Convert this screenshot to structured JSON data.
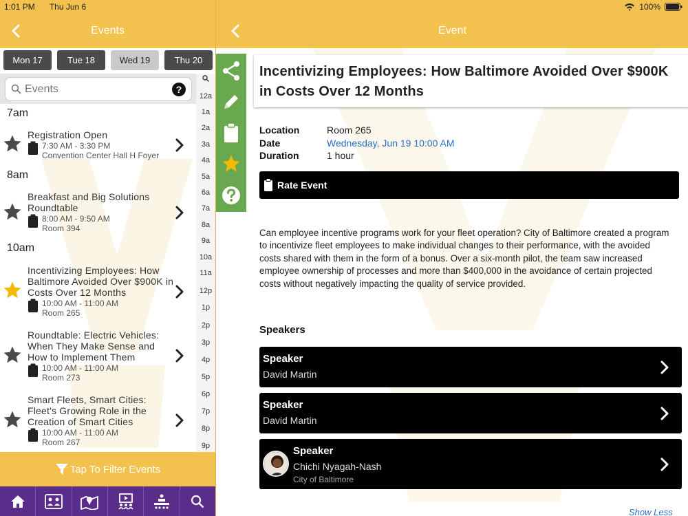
{
  "colors": {
    "accent": "#f2c14e",
    "tabbar": "#5a2d8a",
    "actions": "#6aa84f",
    "star_active": "#f5b800",
    "star_inactive": "#4a4a4a",
    "link": "#2a6fc9"
  },
  "status": {
    "time": "1:01 PM",
    "date": "Thu Jun 6",
    "battery": "100%"
  },
  "left": {
    "nav_title": "Events",
    "days": [
      {
        "label": "Mon 17",
        "active": false
      },
      {
        "label": "Tue 18",
        "active": false
      },
      {
        "label": "Wed 19",
        "active": true
      },
      {
        "label": "Thu 20",
        "active": false
      }
    ],
    "search_placeholder": "Events",
    "help_icon": "?",
    "index": [
      "12a",
      "1a",
      "2a",
      "3a",
      "4a",
      "5a",
      "6a",
      "7a",
      "8a",
      "9a",
      "10a",
      "11a",
      "12p",
      "1p",
      "2p",
      "3p",
      "4p",
      "5p",
      "6p",
      "7p",
      "8p",
      "9p"
    ],
    "hours": [
      "7am",
      "8am",
      "10am"
    ],
    "events": [
      {
        "title": "Registration Open",
        "time": "7:30 AM - 3:30 PM",
        "location": "Convention Center Hall H Foyer",
        "starred": false
      },
      {
        "title": "Breakfast and Big Solutions Roundtable",
        "time": "8:00 AM - 9:50 AM",
        "location": "Room 394",
        "starred": false
      },
      {
        "title": "Incentivizing Employees: How Baltimore Avoided Over $900K in Costs Over 12 Months",
        "time": "10:00 AM - 11:00 AM",
        "location": "Room 265",
        "starred": true
      },
      {
        "title": "Roundtable: Electric Vehicles: When They Make Sense and How to Implement Them",
        "time": "10:00 AM - 11:00 AM",
        "location": "Room 273",
        "starred": false
      },
      {
        "title": "Smart Fleets, Smart Cities: Fleet's Growing Role in the Creation of Smart Cities",
        "time": "10:00 AM - 11:00 AM",
        "location": "Room 267",
        "starred": false
      }
    ],
    "filter_label": "Tap To Filter Events",
    "tabs": [
      "home-icon",
      "attendees-icon",
      "map-icon",
      "presentations-icon",
      "exhibitors-icon",
      "search-icon"
    ]
  },
  "right": {
    "nav_title": "Event",
    "title": "Incentivizing Employees: How Baltimore Avoided Over $900K in Costs Over 12 Months",
    "location_label": "Location",
    "location": "Room 265",
    "date_label": "Date",
    "date": "Wednesday, Jun 19 10:00 AM",
    "duration_label": "Duration",
    "duration": "1 hour",
    "rate_label": "Rate Event",
    "description": "Can employee incentive programs work for your fleet operation? City of Baltimore created a program to incentivize fleet employees to make individual changes to their performance, with the avoided costs shared with them in the form of a bonus. Over a six-month pilot, the team saw increased employee ownership of processes and more than $400,000 in the avoidance of certain projected costs without negatively impacting the quality of service provided.",
    "speakers_heading": "Speakers",
    "speakers": [
      {
        "role": "Speaker",
        "name": "David Martin",
        "org": ""
      },
      {
        "role": "Speaker",
        "name": "David Martin",
        "org": ""
      },
      {
        "role": "Speaker",
        "name": "Chichi Nyagah-Nash",
        "org": "City of Baltimore"
      }
    ],
    "show_less": "Show Less"
  }
}
